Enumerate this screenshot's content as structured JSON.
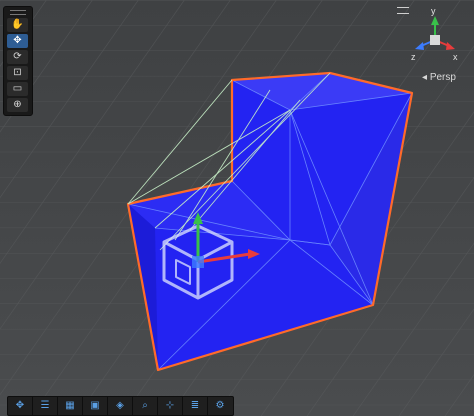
{
  "scene": {
    "camera_mode": "Persp",
    "background_color": "#47494b",
    "mesh_color": "#2222f0",
    "outline_color": "#ff6a2a",
    "wire_color": "#c8f0c8",
    "gizmo_axes": {
      "x": "x",
      "y": "y",
      "z": "z"
    }
  },
  "tools": [
    {
      "name": "hand-tool",
      "glyph": "✋",
      "active": false
    },
    {
      "name": "move-tool",
      "glyph": "✥",
      "active": true
    },
    {
      "name": "rotate-tool",
      "glyph": "⟳",
      "active": false
    },
    {
      "name": "scale-tool",
      "glyph": "⊡",
      "active": false
    },
    {
      "name": "rect-tool",
      "glyph": "▭",
      "active": false
    },
    {
      "name": "transform-tool",
      "glyph": "⊕",
      "active": false
    }
  ],
  "bottom_tools": [
    {
      "name": "move-icon",
      "glyph": "✥"
    },
    {
      "name": "align-icon",
      "glyph": "☰"
    },
    {
      "name": "grid-icon",
      "glyph": "▦"
    },
    {
      "name": "bounds-icon",
      "glyph": "▣"
    },
    {
      "name": "pivot-icon",
      "glyph": "◈"
    },
    {
      "name": "search-icon",
      "glyph": "⌕"
    },
    {
      "name": "snap-icon",
      "glyph": "⊹"
    },
    {
      "name": "layers-icon",
      "glyph": "≣"
    },
    {
      "name": "settings-icon",
      "glyph": "⚙"
    }
  ]
}
